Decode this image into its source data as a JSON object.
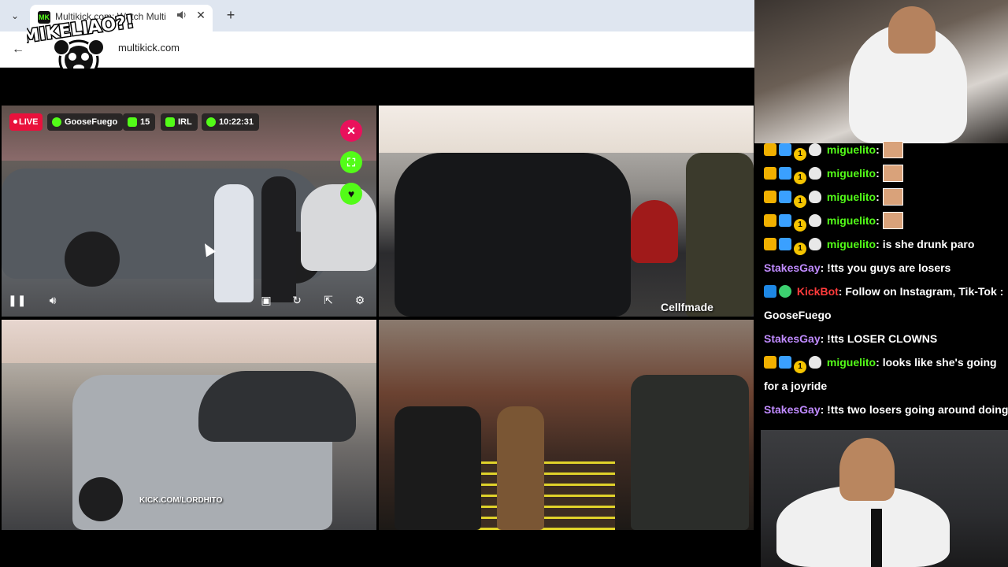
{
  "browser": {
    "tab_title": "Multikick.com: Watch Multi",
    "tab_favicon": "MK",
    "url": "multikick.com",
    "new_tab_label": "+",
    "close_label": "✕",
    "back_label": "←",
    "dropdown_label": "⌄"
  },
  "logo": {
    "text": "MIKELIAO?!"
  },
  "stream": {
    "live_label": "LIVE",
    "streamer": "GooseFuego",
    "viewers": "15",
    "category": "IRL",
    "uptime": "10:22:31"
  },
  "watermarks": {
    "top_right": "Cellfmade",
    "bottom_left": "KICK.COM/LORDHITO"
  },
  "chat": {
    "messages": [
      {
        "user": "miguelito",
        "text": "",
        "badges": [
          "crown",
          "gift",
          "coin",
          "duck"
        ],
        "emote": true
      },
      {
        "user": "miguelito",
        "text": "",
        "badges": [
          "crown",
          "gift",
          "coin",
          "duck"
        ],
        "emote": true
      },
      {
        "user": "miguelito",
        "text": "",
        "badges": [
          "crown",
          "gift",
          "coin",
          "duck"
        ],
        "emote": true
      },
      {
        "user": "miguelito",
        "text": "",
        "badges": [
          "crown",
          "gift",
          "coin",
          "duck"
        ],
        "emote": true
      },
      {
        "user": "miguelito",
        "text": "is she drunk paro",
        "badges": [
          "crown",
          "gift",
          "coin",
          "duck"
        ]
      },
      {
        "user": "StakesGay",
        "text": "!tts you guys are losers"
      },
      {
        "user": "KickBot",
        "text": "Follow on Instagram, Tik-Tok :",
        "badges": [
          "bot",
          "verified"
        ]
      },
      {
        "user": "",
        "text": "GooseFuego"
      },
      {
        "user": "StakesGay",
        "text": "!tts LOSER CLOWNS"
      },
      {
        "user": "miguelito",
        "text": "looks like she's going",
        "badges": [
          "crown",
          "gift",
          "coin",
          "duck"
        ]
      },
      {
        "user": "",
        "text": "for a joyride"
      },
      {
        "user": "StakesGay",
        "text": "!tts two losers going around doing"
      }
    ]
  },
  "icons": {
    "close": "close-icon",
    "fullscreen": "fullscreen-icon",
    "heart": "heart-icon",
    "pause": "pause-icon",
    "volume": "volume-icon",
    "pip": "pip-icon",
    "refresh": "refresh-icon",
    "popout": "popout-icon",
    "settings": "gear-icon"
  },
  "colors": {
    "kick_green": "#53fc18",
    "live_red": "#e9113c",
    "close_pink": "#e9115c",
    "username_green": "#53fc18",
    "username_purple": "#c08bff",
    "bot_red": "#ff3b3b"
  }
}
